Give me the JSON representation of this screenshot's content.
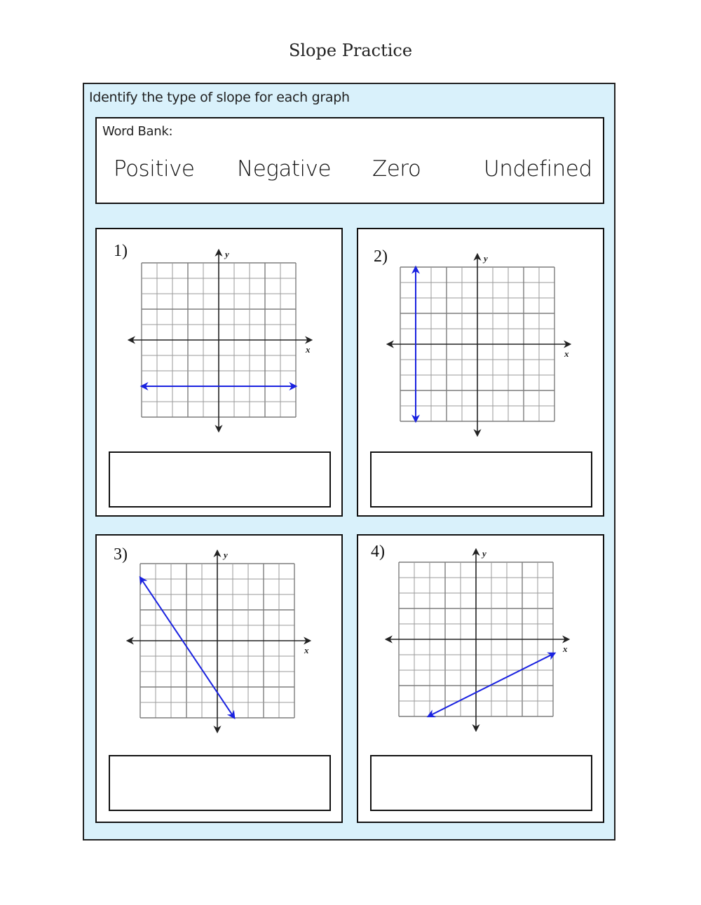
{
  "title": "Slope Practice",
  "instructions": "Identify the type of slope for each graph",
  "word_bank": {
    "label": "Word Bank:",
    "words": [
      "Positive",
      "Negative",
      "Zero",
      "Undefined"
    ]
  },
  "colors": {
    "background": "#d9f1fb",
    "line": "#1a22e0",
    "grid": "#9a9a9a",
    "axis": "#222222"
  },
  "problems": [
    {
      "number": "1)",
      "answer": "",
      "x_label": "x",
      "y_label": "y",
      "line": {
        "x1": -5,
        "y1": -3,
        "x2": 5,
        "y2": -3
      }
    },
    {
      "number": "2)",
      "answer": "",
      "x_label": "x",
      "y_label": "y",
      "line": {
        "x1": -4,
        "y1": 5,
        "x2": -4,
        "y2": -5
      }
    },
    {
      "number": "3)",
      "answer": "",
      "x_label": "x",
      "y_label": "y",
      "line": {
        "x1": -5,
        "y1": 4.1,
        "x2": 1.1,
        "y2": -5
      }
    },
    {
      "number": "4)",
      "answer": "",
      "x_label": "x",
      "y_label": "y",
      "line": {
        "x1": -3.1,
        "y1": -5,
        "x2": 5.1,
        "y2": -0.9
      }
    }
  ],
  "chart_data": [
    {
      "type": "line",
      "title": "1)",
      "xlabel": "x",
      "ylabel": "y",
      "xlim": [
        -5,
        5
      ],
      "ylim": [
        -5,
        5
      ],
      "grid": true,
      "series": [
        {
          "name": "line",
          "x": [
            -5,
            5
          ],
          "y": [
            -3,
            -3
          ]
        }
      ]
    },
    {
      "type": "line",
      "title": "2)",
      "xlabel": "x",
      "ylabel": "y",
      "xlim": [
        -5,
        5
      ],
      "ylim": [
        -5,
        5
      ],
      "grid": true,
      "series": [
        {
          "name": "line",
          "x": [
            -4,
            -4
          ],
          "y": [
            5,
            -5
          ]
        }
      ]
    },
    {
      "type": "line",
      "title": "3)",
      "xlabel": "x",
      "ylabel": "y",
      "xlim": [
        -5,
        5
      ],
      "ylim": [
        -5,
        5
      ],
      "grid": true,
      "series": [
        {
          "name": "line",
          "x": [
            -5,
            1.1
          ],
          "y": [
            4.1,
            -5
          ]
        }
      ]
    },
    {
      "type": "line",
      "title": "4)",
      "xlabel": "x",
      "ylabel": "y",
      "xlim": [
        -5,
        5
      ],
      "ylim": [
        -5,
        5
      ],
      "grid": true,
      "series": [
        {
          "name": "line",
          "x": [
            -3.1,
            5.1
          ],
          "y": [
            -5,
            -0.9
          ]
        }
      ]
    }
  ]
}
